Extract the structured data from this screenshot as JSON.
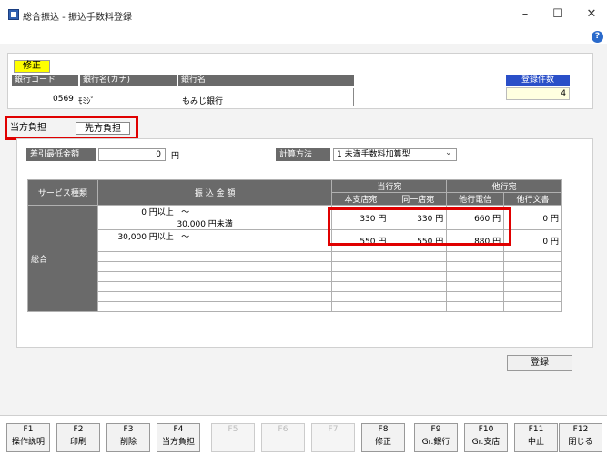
{
  "window": {
    "title": "総合振込 - 振込手数料登録",
    "controls": {
      "minimize": "–",
      "maximize": "☐",
      "close": "✕"
    },
    "help": "?"
  },
  "header": {
    "badge": "修正",
    "columns": {
      "code": "銀行コード",
      "kana": "銀行名(カナ)",
      "name": "銀行名"
    },
    "bank_code": "0569",
    "bank_kana": "ﾓﾐｼﾞ",
    "bank_name": "もみじ銀行",
    "count_label": "登録件数",
    "count_value": "4"
  },
  "tabs": [
    {
      "label": "当方負担"
    },
    {
      "label": "先方負担"
    }
  ],
  "deduct": {
    "label": "差引最低金額",
    "value": "0",
    "unit": "円"
  },
  "calc": {
    "label": "計算方法",
    "value": "1 未満手数料加算型",
    "arrow": "⌄"
  },
  "table": {
    "h_service": "サービス種類",
    "h_amount": "振 込 金 額",
    "h_own_bank": "当行宛",
    "h_other_bank": "他行宛",
    "h_sub": [
      "本支店宛",
      "同一店宛",
      "他行電信",
      "他行文書"
    ],
    "service": "総合",
    "rows": [
      {
        "from": "0 円以上",
        "tilde": "～",
        "to": "30,000 円未満",
        "v1": "330 円",
        "v2": "330 円",
        "v3": "660 円",
        "v4": "0 円"
      },
      {
        "from": "30,000 円以上",
        "tilde": "～",
        "to": "",
        "v1": "550 円",
        "v2": "550 円",
        "v3": "880 円",
        "v4": "0 円"
      }
    ]
  },
  "buttons": {
    "register": "登録"
  },
  "fkeys": [
    {
      "fn": "F1",
      "label": "操作説明"
    },
    {
      "fn": "F2",
      "label": "印刷"
    },
    {
      "fn": "F3",
      "label": "削除"
    },
    {
      "fn": "F4",
      "label": "当方負担"
    },
    {
      "fn": "F5",
      "label": ""
    },
    {
      "fn": "F6",
      "label": ""
    },
    {
      "fn": "F7",
      "label": ""
    },
    {
      "fn": "F8",
      "label": "修正"
    },
    {
      "fn": "F9",
      "label": "Gr.銀行"
    },
    {
      "fn": "F10",
      "label": "Gr.支店"
    },
    {
      "fn": "F11",
      "label": "中止"
    },
    {
      "fn": "F12",
      "label": "閉じる"
    }
  ]
}
